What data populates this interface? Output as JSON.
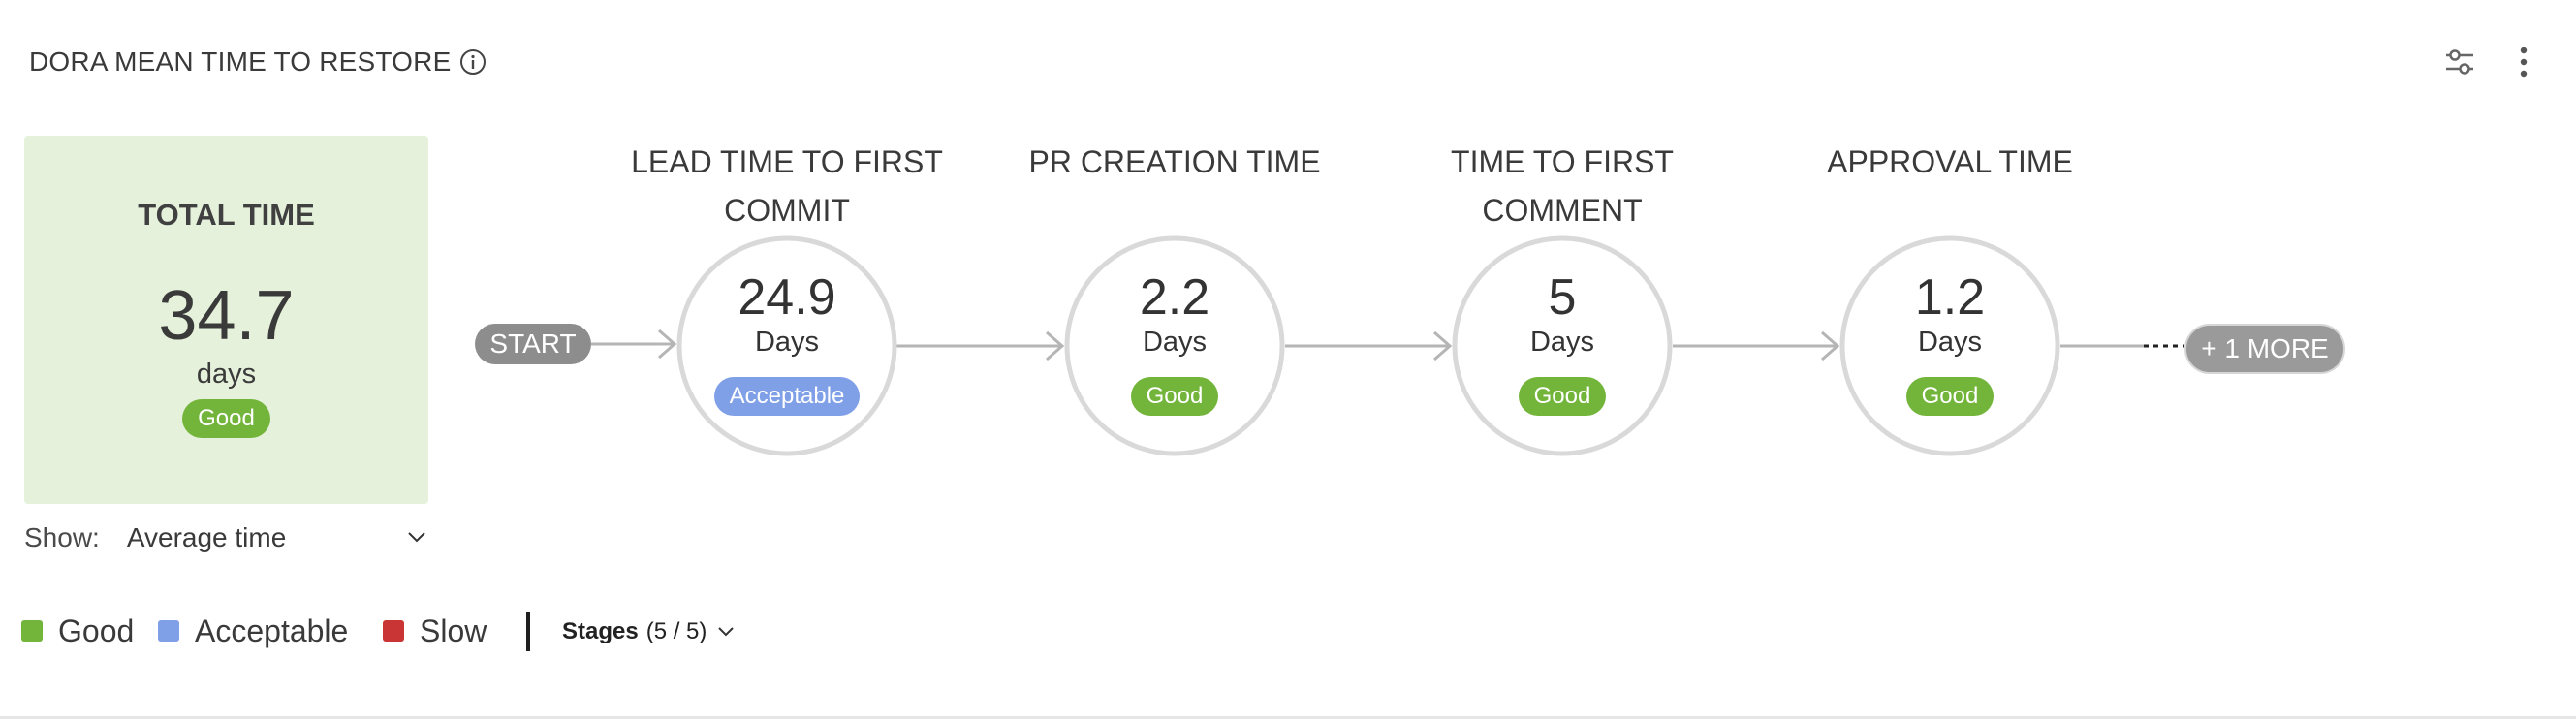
{
  "header": {
    "title": "DORA MEAN TIME TO RESTORE",
    "info_icon": "info-circle-icon",
    "settings_icon": "sliders-icon",
    "menu_icon": "kebab-menu-icon"
  },
  "total": {
    "title": "TOTAL TIME",
    "value": "34.7",
    "unit": "days",
    "status": "Good"
  },
  "show": {
    "label": "Show:",
    "value": "Average time"
  },
  "flow": {
    "start_label": "START",
    "more_label": "+ 1 MORE",
    "stages": [
      {
        "label_line1": "LEAD TIME TO FIRST",
        "label_line2": "COMMIT",
        "value": "24.9",
        "unit": "Days",
        "status": "Acceptable"
      },
      {
        "label_line1": "PR CREATION TIME",
        "label_line2": "",
        "value": "2.2",
        "unit": "Days",
        "status": "Good"
      },
      {
        "label_line1": "TIME TO FIRST",
        "label_line2": "COMMENT",
        "value": "5",
        "unit": "Days",
        "status": "Good"
      },
      {
        "label_line1": "APPROVAL TIME",
        "label_line2": "",
        "value": "1.2",
        "unit": "Days",
        "status": "Good"
      }
    ]
  },
  "legend": {
    "items": [
      {
        "label": "Good",
        "color": "#72b53a"
      },
      {
        "label": "Acceptable",
        "color": "#7f9fe7"
      },
      {
        "label": "Slow",
        "color": "#c93434"
      }
    ]
  },
  "stages_filter": {
    "label": "Stages",
    "count": "(5 / 5)"
  },
  "colors": {
    "good": "#72b53a",
    "acceptable": "#7f9fe7",
    "slow": "#c93434",
    "total_card_bg": "#e5f1db"
  }
}
